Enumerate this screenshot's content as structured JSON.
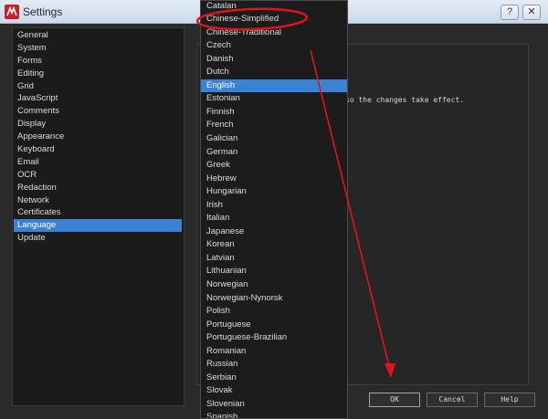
{
  "window": {
    "title": "Settings",
    "help_button": "?",
    "close_button": "✕"
  },
  "sidebar": {
    "items": [
      "General",
      "System",
      "Forms",
      "Editing",
      "Grid",
      "JavaScript",
      "Comments",
      "Display",
      "Appearance",
      "Keyboard",
      "Email",
      "OCR",
      "Redaction",
      "Network",
      "Certificates",
      "Language",
      "Update"
    ],
    "selected": "Language"
  },
  "language_dropdown": {
    "options": [
      "Catalan",
      "Chinese-Simplified",
      "Chinese-Traditional",
      "Czech",
      "Danish",
      "Dutch",
      "English",
      "Estonian",
      "Finnish",
      "French",
      "Galician",
      "German",
      "Greek",
      "Hebrew",
      "Hungarian",
      "Irish",
      "Italian",
      "Japanese",
      "Korean",
      "Latvian",
      "Lithuanian",
      "Norwegian",
      "Norwegian-Nynorsk",
      "Polish",
      "Portuguese",
      "Portuguese-Brazilian",
      "Romanian",
      "Russian",
      "Serbian",
      "Slovak",
      "Slovenian",
      "Spanish"
    ],
    "selected": "English",
    "highlighted_by_annotation": "Chinese-Simplified"
  },
  "content": {
    "note": "so the changes take effect."
  },
  "buttons": {
    "ok": "OK",
    "cancel": "Cancel",
    "help": "Help"
  },
  "colors": {
    "accent": "#3a82d6",
    "annotation": "#e0141e"
  }
}
